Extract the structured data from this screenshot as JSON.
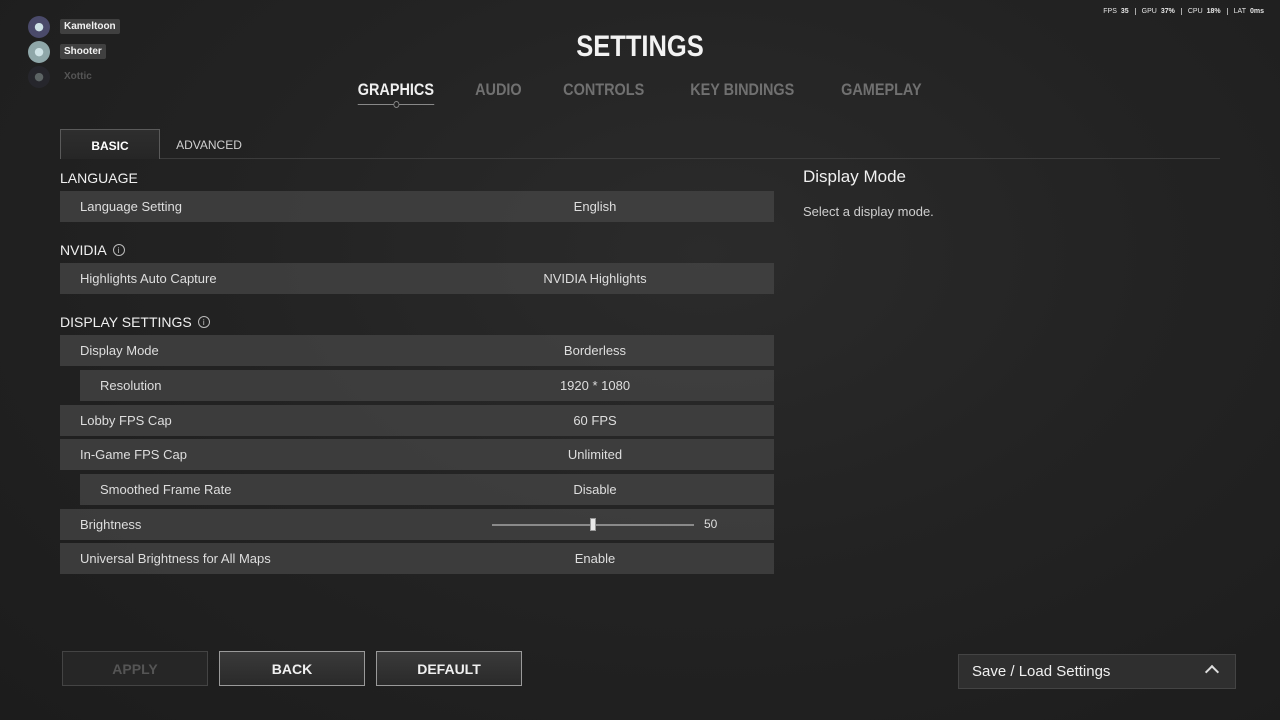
{
  "party": [
    {
      "name": "Kameltoon"
    },
    {
      "name": "Shooter"
    },
    {
      "name": "Xottic"
    }
  ],
  "stats": [
    {
      "label": "FPS",
      "value": "35"
    },
    {
      "label": "GPU",
      "value": "37%"
    },
    {
      "label": "CPU",
      "value": "18%"
    },
    {
      "label": "LAT",
      "value": "0ms"
    }
  ],
  "title": "SETTINGS",
  "main_tabs": [
    "GRAPHICS",
    "AUDIO",
    "CONTROLS",
    "KEY BINDINGS",
    "GAMEPLAY"
  ],
  "sub_tabs": [
    "BASIC",
    "ADVANCED"
  ],
  "sections": {
    "language": "LANGUAGE",
    "nvidia": "NVIDIA",
    "display": "DISPLAY SETTINGS"
  },
  "rows": {
    "language_setting": {
      "label": "Language Setting",
      "value": "English"
    },
    "highlights": {
      "label": "Highlights Auto Capture",
      "value": "NVIDIA Highlights"
    },
    "display_mode": {
      "label": "Display Mode",
      "value": "Borderless"
    },
    "resolution": {
      "label": "Resolution",
      "value": "1920 * 1080"
    },
    "lobby_fps": {
      "label": "Lobby FPS Cap",
      "value": "60 FPS"
    },
    "ingame_fps": {
      "label": "In-Game FPS Cap",
      "value": "Unlimited"
    },
    "smoothed": {
      "label": "Smoothed Frame Rate",
      "value": "Disable"
    },
    "brightness": {
      "label": "Brightness",
      "value": "50",
      "level": 0.5
    },
    "universal_brightness": {
      "label": "Universal Brightness for All Maps",
      "value": "Enable"
    }
  },
  "detail": {
    "title": "Display Mode",
    "text": "Select a display mode."
  },
  "buttons": {
    "apply": "APPLY",
    "back": "BACK",
    "default": "DEFAULT"
  },
  "save_load": "Save / Load Settings"
}
